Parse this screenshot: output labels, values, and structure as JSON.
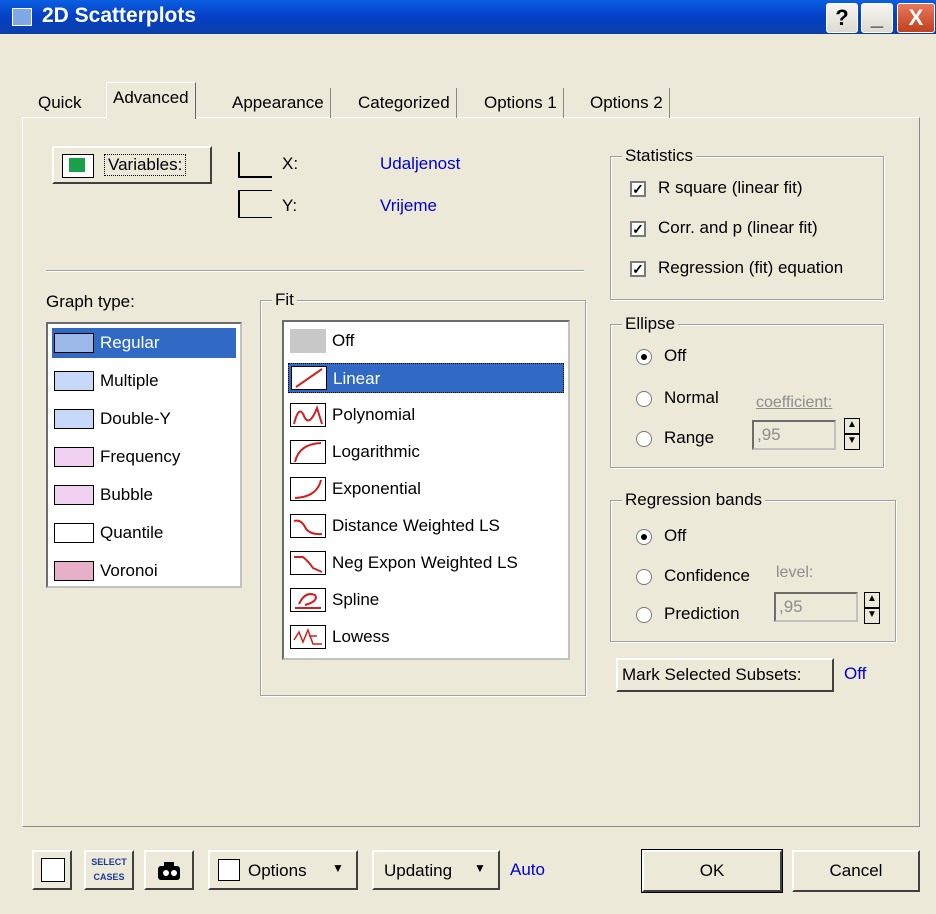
{
  "window": {
    "title": "2D Scatterplots"
  },
  "title_buttons": {
    "help": "?",
    "minimize": "_",
    "close": "X"
  },
  "tabs": [
    {
      "label": "Quick"
    },
    {
      "label": "Advanced"
    },
    {
      "label": "Appearance"
    },
    {
      "label": "Categorized"
    },
    {
      "label": "Options 1"
    },
    {
      "label": "Options 2"
    }
  ],
  "variables": {
    "button_label": "Variables:",
    "x_label": "X:",
    "x_value": "Udaljenost",
    "y_label": "Y:",
    "y_value": "Vrijeme"
  },
  "graph_type": {
    "label": "Graph type:",
    "items": [
      {
        "label": "Regular",
        "icon": "scatter-regular-icon"
      },
      {
        "label": "Multiple",
        "icon": "scatter-multiple-icon"
      },
      {
        "label": "Double-Y",
        "icon": "scatter-double-y-icon"
      },
      {
        "label": "Frequency",
        "icon": "scatter-frequency-icon"
      },
      {
        "label": "Bubble",
        "icon": "scatter-bubble-icon"
      },
      {
        "label": "Quantile",
        "icon": "scatter-quantile-icon"
      },
      {
        "label": "Voronoi",
        "icon": "scatter-voronoi-icon"
      }
    ],
    "selected": "Regular"
  },
  "fit": {
    "label": "Fit",
    "items": [
      {
        "label": "Off",
        "icon": "fit-off-icon"
      },
      {
        "label": "Linear",
        "icon": "fit-linear-icon"
      },
      {
        "label": "Polynomial",
        "icon": "fit-polynomial-icon"
      },
      {
        "label": "Logarithmic",
        "icon": "fit-logarithmic-icon"
      },
      {
        "label": "Exponential",
        "icon": "fit-exponential-icon"
      },
      {
        "label": "Distance Weighted LS",
        "icon": "fit-distance-weighted-icon"
      },
      {
        "label": "Neg Expon Weighted LS",
        "icon": "fit-neg-expon-icon"
      },
      {
        "label": "Spline",
        "icon": "fit-spline-icon"
      },
      {
        "label": "Lowess",
        "icon": "fit-lowess-icon"
      }
    ],
    "selected": "Linear"
  },
  "statistics": {
    "label": "Statistics",
    "items": [
      {
        "label": "R square (linear fit)",
        "checked": true
      },
      {
        "label": "Corr. and p (linear fit)",
        "checked": true
      },
      {
        "label": "Regression (fit) equation",
        "checked": true
      }
    ]
  },
  "ellipse": {
    "label": "Ellipse",
    "options": [
      {
        "label": "Off",
        "selected": true
      },
      {
        "label": "Normal",
        "selected": false
      },
      {
        "label": "Range",
        "selected": false
      }
    ],
    "coefficient_label": "coefficient:",
    "coefficient_value": ",95"
  },
  "regression_bands": {
    "label": "Regression bands",
    "options": [
      {
        "label": "Off",
        "selected": true
      },
      {
        "label": "Confidence",
        "selected": false
      },
      {
        "label": "Prediction",
        "selected": false
      }
    ],
    "level_label": "level:",
    "level_value": ",95"
  },
  "mark_subsets": {
    "button_label": "Mark Selected Subsets:",
    "value": "Off"
  },
  "bottom": {
    "select_cases": "SELECT CASES",
    "options_label": "Options",
    "updating_label": "Updating",
    "updating_value": "Auto",
    "ok_label": "OK",
    "cancel_label": "Cancel"
  },
  "colors": {
    "title_bar": "#0a48d0",
    "selection": "#316ac5",
    "link_value": "#0000cc",
    "dialog_bg": "#ece9d8"
  }
}
